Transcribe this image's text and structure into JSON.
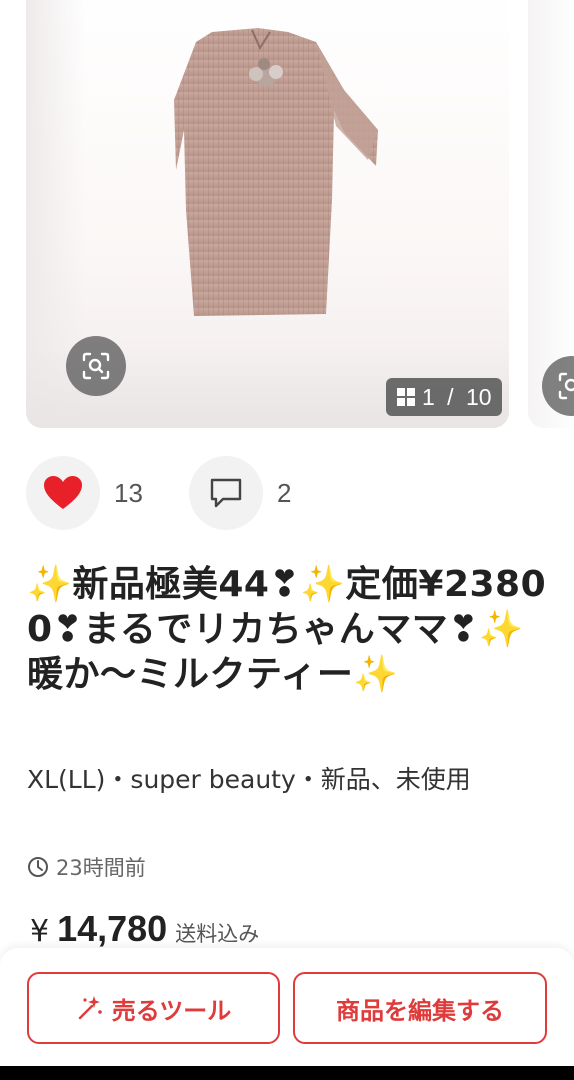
{
  "carousel": {
    "counter_current": "1",
    "counter_sep": " / ",
    "counter_total": "10"
  },
  "reactions": {
    "like_count": "13",
    "comment_count": "2"
  },
  "item": {
    "title": "✨新品極美44❣✨定価¥23800❣まるでリカちゃんママ❣✨暖か〜ミルクティー✨",
    "meta": "XL(LL)・super  beauty・新品、未使用",
    "time": "23時間前",
    "price_symbol": "¥",
    "price": "14,780",
    "shipping": "送料込み"
  },
  "actions": {
    "sell_tool_label": "売るツール",
    "edit_label": "商品を編集する"
  },
  "colors": {
    "accent": "#e03b3b",
    "heart": "#e8202a"
  }
}
